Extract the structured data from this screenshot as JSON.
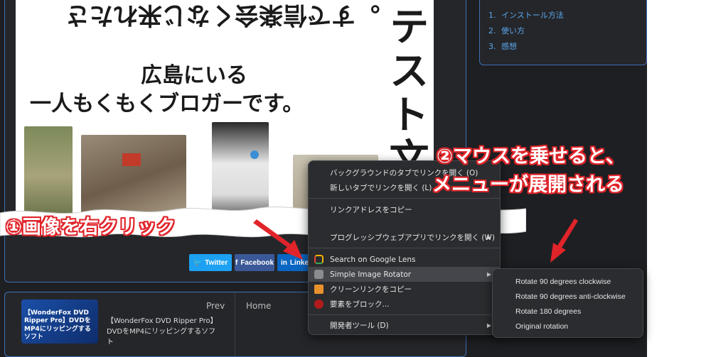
{
  "article": {
    "image": {
      "flipped_line": "。すで信楽会くなじ来れたさ",
      "line1": "広島にいる",
      "line2": "一人もくもくブロガーです。",
      "vertical": "テスト文"
    },
    "share": {
      "twitter": "Twitter",
      "facebook": "Facebook",
      "linkedin": "Linkedin"
    }
  },
  "toc": {
    "items": [
      {
        "num": "1.",
        "label": "インストール方法"
      },
      {
        "num": "2.",
        "label": "使い方"
      },
      {
        "num": "3.",
        "label": "感想"
      }
    ]
  },
  "nav": {
    "prev_label": "Prev",
    "home_label": "Home",
    "prev_thumb_text": "【WonderFox DVD Ripper Pro】DVDをMP4にリッピングするソフト",
    "prev_title": "【WonderFox DVD Ripper Pro】DVDをMP4にリッピングするソフト"
  },
  "context_menu": {
    "items": [
      {
        "label": "バックグラウンドのタブでリンクを開く (O)",
        "submenu": false
      },
      {
        "label": "新しいタブでリンクを開く (L)",
        "submenu": false
      },
      {
        "label": "リンクアドレスをコピー",
        "submenu": false
      },
      {
        "label": "プログレッシブウェブアプリでリンクを開く (W)",
        "submenu": true
      },
      {
        "label": "Search on Google Lens",
        "submenu": false,
        "icon": "google-lens-icon"
      },
      {
        "label": "Simple Image Rotator",
        "submenu": true,
        "icon": "puzzle-icon"
      },
      {
        "label": "クリーンリンクをコピー",
        "submenu": false,
        "icon": "clean-link-icon"
      },
      {
        "label": "要素をブロック...",
        "submenu": false,
        "icon": "ublock-icon"
      },
      {
        "label": "開発者ツール (D)",
        "submenu": true
      }
    ]
  },
  "sub_menu": {
    "items": [
      "Rotate 90 degrees clockwise",
      "Rotate 90 degrees anti-clockwise",
      "Rotate 180 degrees",
      "Original rotation"
    ]
  },
  "annotations": {
    "step1": "①画像を右クリック",
    "step2_line1": "②マウスを乗せると、",
    "step2_line2": "メニューが展開される"
  },
  "colors": {
    "accent_blue": "#3b6fb5",
    "annotation_red": "#e0242a",
    "twitter": "#1da1f2",
    "facebook": "#3b5998",
    "linkedin": "#0a66c2"
  }
}
